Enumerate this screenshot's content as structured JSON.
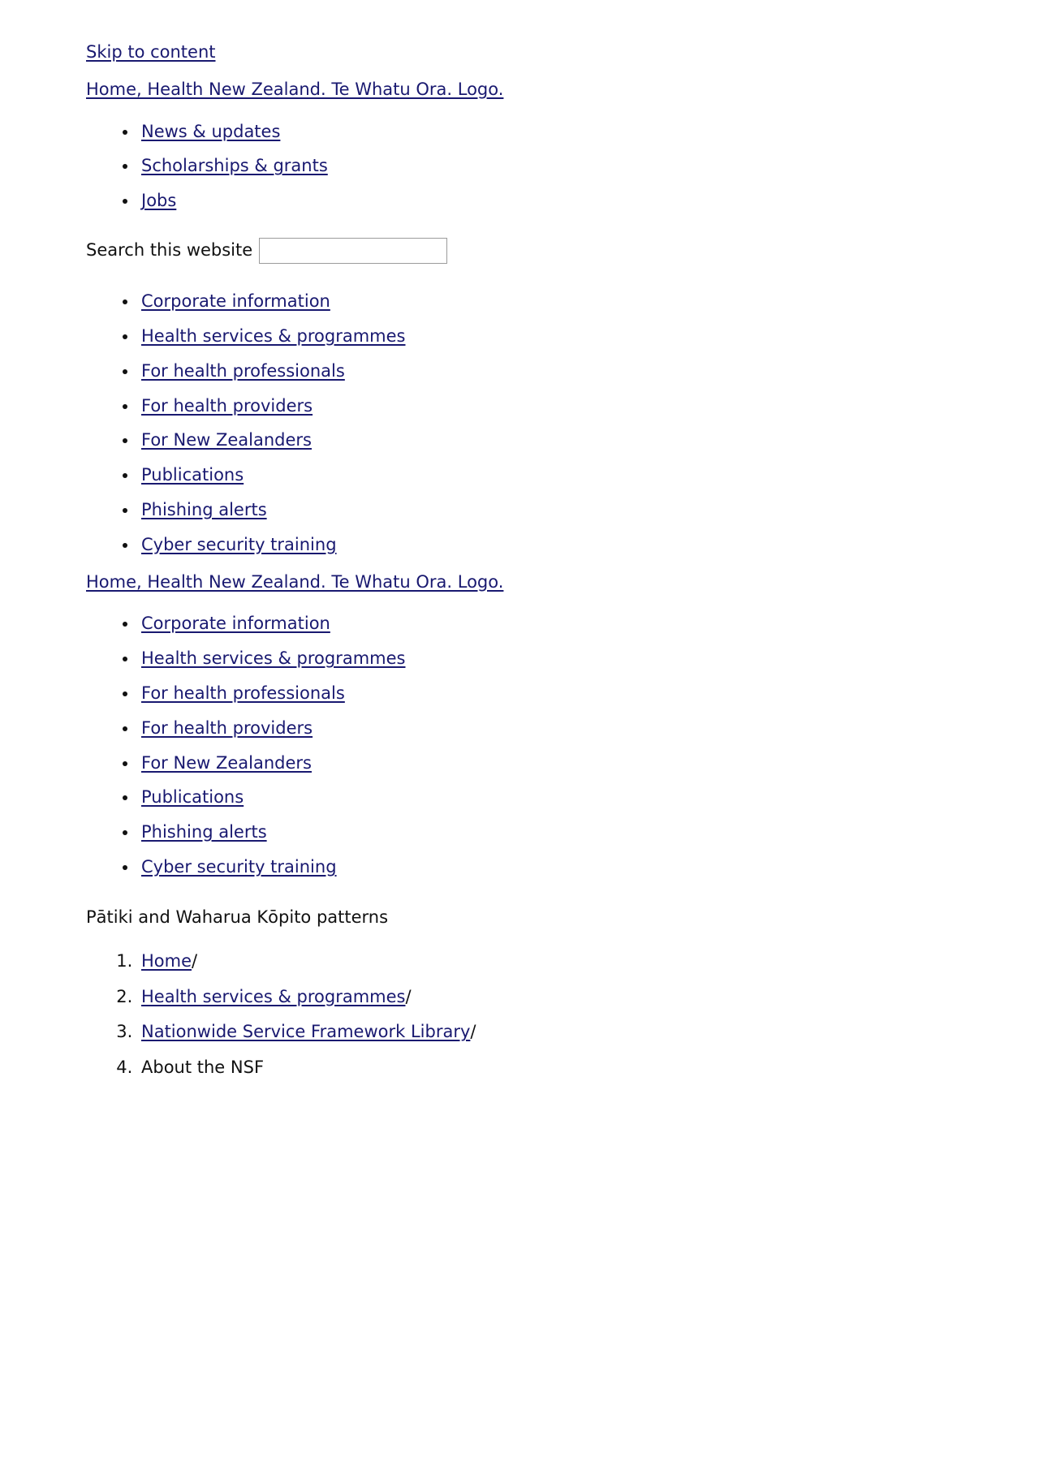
{
  "skip": {
    "label": "Skip to content "
  },
  "brand": {
    "home_link_top": "Home, Health New Zealand. Te Whatu Ora. Logo. ",
    "home_link_second": "Home, Health New Zealand. Te Whatu Ora. Logo. "
  },
  "utility_nav": {
    "items": [
      {
        "label": "News & updates "
      },
      {
        "label": "Scholarships & grants "
      },
      {
        "label": "Jobs "
      }
    ]
  },
  "search": {
    "label": "Search this website",
    "value": "",
    "placeholder": ""
  },
  "primary_nav": {
    "items": [
      {
        "label": "Corporate information "
      },
      {
        "label": "Health services & programmes "
      },
      {
        "label": "For health professionals "
      },
      {
        "label": "For health providers "
      },
      {
        "label": "For New Zealanders "
      },
      {
        "label": "Publications "
      },
      {
        "label": "Phishing alerts "
      },
      {
        "label": "Cyber security training "
      }
    ]
  },
  "secondary_nav": {
    "items": [
      {
        "label": "Corporate information"
      },
      {
        "label": "Health services & programmes"
      },
      {
        "label": "For health professionals"
      },
      {
        "label": "For health providers"
      },
      {
        "label": "For New Zealanders"
      },
      {
        "label": "Publications"
      },
      {
        "label": "Phishing alerts"
      },
      {
        "label": "Cyber security training"
      }
    ]
  },
  "decor": {
    "patterns_caption": "Pātiki and Waharua Kōpito patterns"
  },
  "breadcrumb": {
    "separator": "/",
    "items": [
      {
        "label": "Home",
        "is_link": true,
        "separator": "/"
      },
      {
        "label": "Health services & programmes",
        "is_link": true,
        "separator": "/"
      },
      {
        "label": "Nationwide Service Framework Library",
        "is_link": true,
        "separator": "/"
      },
      {
        "label": "About the NSF",
        "is_link": false,
        "separator": ""
      }
    ]
  },
  "colors": {
    "link": "#191970",
    "text": "#111111",
    "background": "#ffffff",
    "input_border": "#9b9b9b"
  }
}
